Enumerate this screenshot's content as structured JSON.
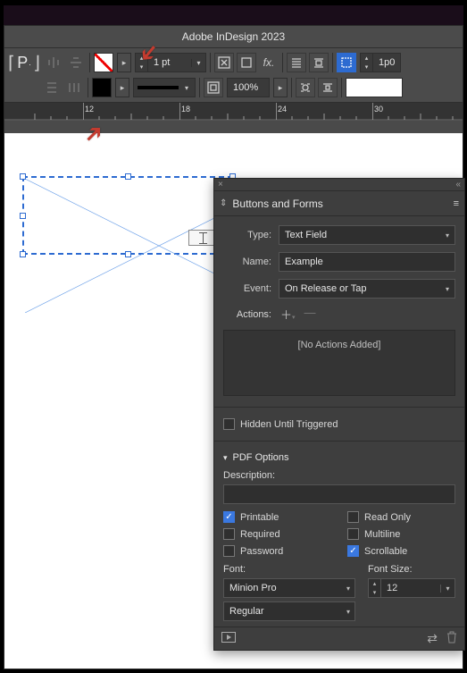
{
  "app": {
    "title": "Adobe InDesign 2023"
  },
  "control_panel": {
    "stroke_weight": "1 pt",
    "opacity": "100%",
    "inset": "1p0"
  },
  "ruler": {
    "labels": [
      "12",
      "18",
      "24",
      "30"
    ]
  },
  "panel": {
    "title": "Buttons and Forms",
    "type_label": "Type:",
    "type_value": "Text Field",
    "name_label": "Name:",
    "name_value": "Example",
    "event_label": "Event:",
    "event_value": "On Release or Tap",
    "actions_label": "Actions:",
    "no_actions": "[No Actions Added]",
    "hidden_until_triggered": "Hidden Until Triggered",
    "pdf_options": "PDF Options",
    "description_label": "Description:",
    "printable": "Printable",
    "read_only": "Read Only",
    "required": "Required",
    "multiline": "Multiline",
    "password": "Password",
    "scrollable": "Scrollable",
    "font_label": "Font:",
    "font_size_label": "Font Size:",
    "font_family": "Minion Pro",
    "font_style": "Regular",
    "font_size": "12"
  }
}
